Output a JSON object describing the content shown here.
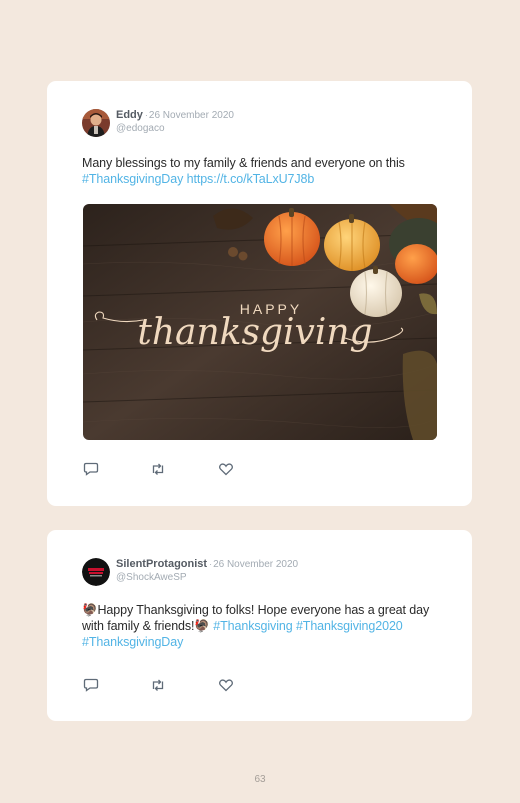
{
  "tweets": [
    {
      "name": "Eddy",
      "separator": "·",
      "date": "26 November 2020",
      "handle": "@edogaco",
      "text_plain": "Many blessings to my family & friends and everyone on this ",
      "hashtag": "#ThanksgivingDay",
      "link": " https://t.co/kTaLxU7J8b",
      "image": {
        "title_small": "HAPPY",
        "title_script": "thanksgiving"
      },
      "actions": {
        "reply_icon": "reply-icon",
        "retweet_icon": "retweet-icon",
        "like_icon": "heart-icon"
      }
    },
    {
      "name": "SilentProtagonist",
      "separator": "·",
      "date": "26 November 2020",
      "handle": "@ShockAweSP",
      "emoji": "🦃",
      "text_plain": "Happy Thanksgiving to folks! Hope everyone has a great day with family & friends!",
      "hashtags": "#Thanksgiving #Thanksgiving2020 #ThanksgivingDay",
      "actions": {
        "reply_icon": "reply-icon",
        "retweet_icon": "retweet-icon",
        "like_icon": "heart-icon"
      }
    }
  ],
  "page_number": "63",
  "colors": {
    "background": "#f3e8de",
    "card": "#ffffff",
    "link": "#52b4e5",
    "icon": "#5f6b78"
  }
}
